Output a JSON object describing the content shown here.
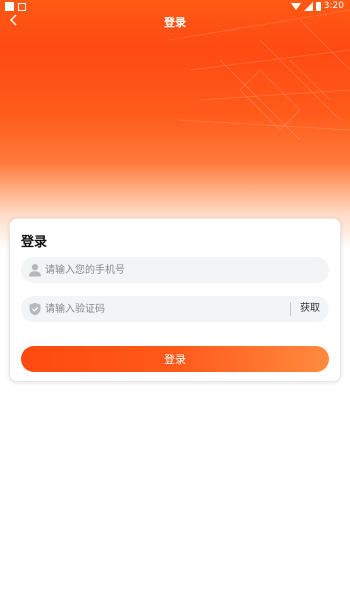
{
  "status_bar": {
    "time": "3:20"
  },
  "nav": {
    "title": "登录"
  },
  "card": {
    "title": "登录",
    "phone_placeholder": "请输入您的手机号",
    "code_placeholder": "请输入验证码",
    "get_code_label": "获取",
    "login_label": "登录"
  },
  "colors": {
    "brand": "#ff5214",
    "brand_light": "#ff8a40",
    "field_bg": "#f3f4f6"
  },
  "icons": {
    "back": "chevron-left-icon",
    "phone_field": "user-icon",
    "code_field": "shield-check-icon"
  }
}
